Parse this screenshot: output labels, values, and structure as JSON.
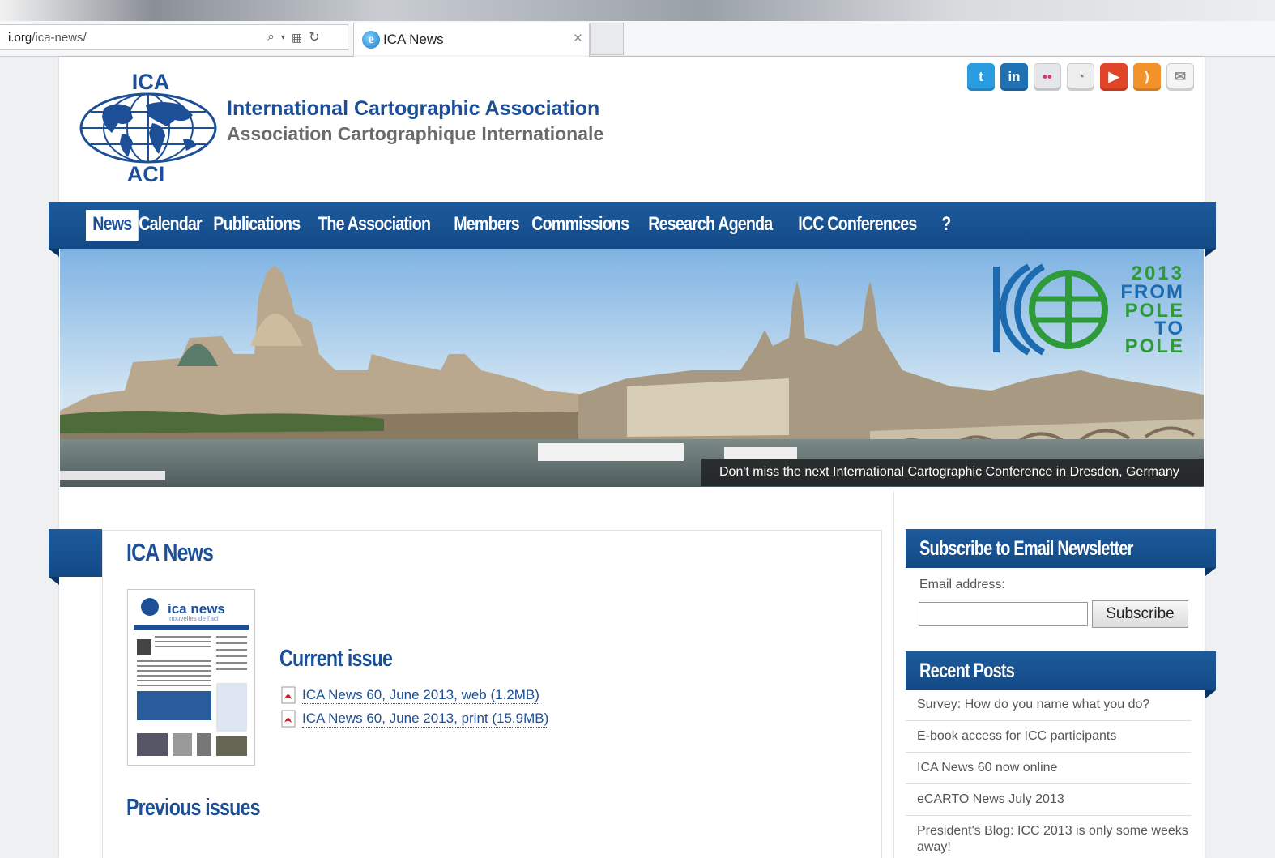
{
  "browser": {
    "address_host": "i.org",
    "address_path": "/ica-news/",
    "tab_title": "ICA News",
    "tab_close": "×"
  },
  "site": {
    "logo_top": "ICA",
    "logo_bottom": "ACI",
    "name_en": "International Cartographic Association",
    "name_fr": "Association Cartographique Internationale"
  },
  "social": [
    {
      "name": "twitter-icon",
      "glyph": "t",
      "color": "#2b9be0"
    },
    {
      "name": "linkedin-icon",
      "glyph": "in",
      "color": "#2070b4"
    },
    {
      "name": "flickr-icon",
      "glyph": "••",
      "color": "#e4e6ea"
    },
    {
      "name": "picasa-icon",
      "glyph": "◔",
      "color": "#eeeeee"
    },
    {
      "name": "youtube-icon",
      "glyph": "▶",
      "color": "#e0452a"
    },
    {
      "name": "rss-icon",
      "glyph": ")",
      "color": "#f3912a"
    },
    {
      "name": "email-icon",
      "glyph": "✉",
      "color": "#f4f4f4"
    }
  ],
  "nav": {
    "items": [
      "News",
      "Calendar",
      "Publications",
      "The Association",
      "Members",
      "Commissions",
      "Research Agenda",
      "ICC Conferences",
      "?"
    ]
  },
  "banner": {
    "logo_text": [
      "2013",
      "FROM",
      "POLE",
      "TO",
      "POLE"
    ],
    "caption": "Don't miss the next International Cartographic Conference in Dresden, Germany"
  },
  "main": {
    "title": "ICA News",
    "cover_title": "ica news",
    "cover_subtitle": "nouvelles de l'aci",
    "current_heading": "Current issue",
    "links": [
      "ICA News 60, June 2013, web (1.2MB)",
      "ICA News 60, June 2013, print (15.9MB)"
    ],
    "previous_heading": "Previous issues"
  },
  "sidebar": {
    "newsletter_heading": "Subscribe to Email Newsletter",
    "email_label": "Email address:",
    "subscribe_label": "Subscribe",
    "recent_heading": "Recent Posts",
    "posts": [
      "Survey: How do you name what you do?",
      "E-book access for ICC participants",
      "ICA News 60 now online",
      "eCARTO News July 2013",
      "President's Blog: ICC 2013 is only some weeks away!"
    ]
  }
}
